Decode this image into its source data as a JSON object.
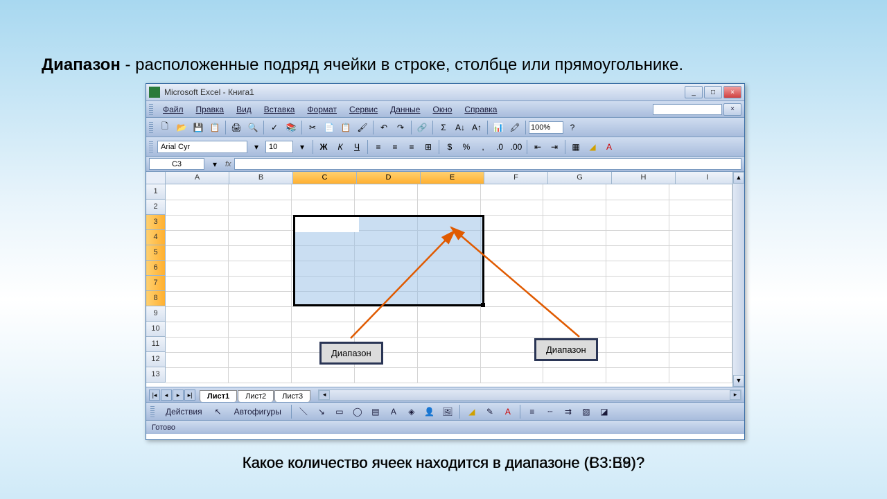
{
  "slide": {
    "title_bold": "Диапазон",
    "title_rest": " - расположенные подряд ячейки в строке, столбце или прямоугольнике.",
    "question_layer1": "Какое количество ячеек находится в диапазоне (B3:B9)?",
    "question_layer2": "Какое количество ячеек находится в диапазоне (C3:E8)?"
  },
  "window": {
    "title": "Microsoft Excel - Книга1",
    "minimize": "_",
    "maximize": "□",
    "close": "×"
  },
  "menu": {
    "file": "Файл",
    "edit": "Правка",
    "view": "Вид",
    "insert": "Вставка",
    "format": "Формат",
    "tools": "Сервис",
    "data": "Данные",
    "window": "Окно",
    "help": "Справка"
  },
  "toolbar": {
    "zoom": "100%"
  },
  "format": {
    "font_name": "Arial Cyr",
    "font_size": "10",
    "bold": "Ж",
    "italic": "К",
    "underline": "Ч"
  },
  "namebox": {
    "cell_ref": "C3",
    "fx": "fx"
  },
  "columns": [
    "A",
    "B",
    "C",
    "D",
    "E",
    "F",
    "G",
    "H",
    "I"
  ],
  "rows": [
    "1",
    "2",
    "3",
    "4",
    "5",
    "6",
    "7",
    "8",
    "9",
    "10",
    "11",
    "12",
    "13"
  ],
  "selected_cols": [
    "C",
    "D",
    "E"
  ],
  "selected_rows": [
    "3",
    "4",
    "5",
    "6",
    "7",
    "8"
  ],
  "callouts": {
    "label1": "Диапазон",
    "label2": "Диапазон"
  },
  "sheets": {
    "sheet1": "Лист1",
    "sheet2": "Лист2",
    "sheet3": "Лист3"
  },
  "drawbar": {
    "actions": "Действия",
    "autoshapes": "Автофигуры"
  },
  "status": {
    "ready": "Готово"
  }
}
